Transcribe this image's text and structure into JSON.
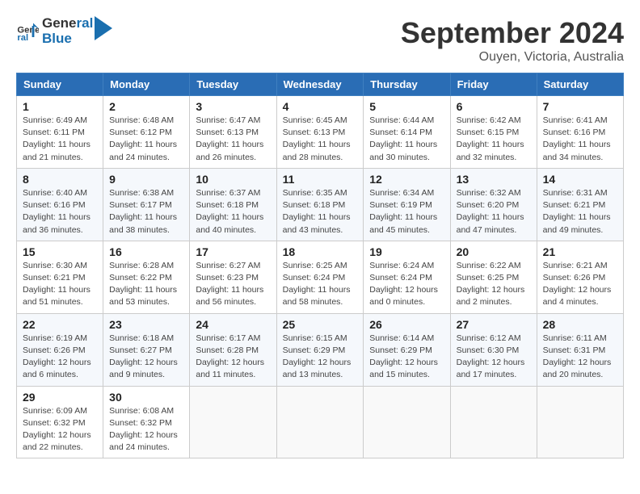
{
  "header": {
    "logo_line1": "General",
    "logo_line2": "Blue",
    "month_year": "September 2024",
    "location": "Ouyen, Victoria, Australia"
  },
  "weekdays": [
    "Sunday",
    "Monday",
    "Tuesday",
    "Wednesday",
    "Thursday",
    "Friday",
    "Saturday"
  ],
  "weeks": [
    [
      {
        "day": "1",
        "sunrise": "6:49 AM",
        "sunset": "6:11 PM",
        "daylight": "11 hours and 21 minutes."
      },
      {
        "day": "2",
        "sunrise": "6:48 AM",
        "sunset": "6:12 PM",
        "daylight": "11 hours and 24 minutes."
      },
      {
        "day": "3",
        "sunrise": "6:47 AM",
        "sunset": "6:13 PM",
        "daylight": "11 hours and 26 minutes."
      },
      {
        "day": "4",
        "sunrise": "6:45 AM",
        "sunset": "6:13 PM",
        "daylight": "11 hours and 28 minutes."
      },
      {
        "day": "5",
        "sunrise": "6:44 AM",
        "sunset": "6:14 PM",
        "daylight": "11 hours and 30 minutes."
      },
      {
        "day": "6",
        "sunrise": "6:42 AM",
        "sunset": "6:15 PM",
        "daylight": "11 hours and 32 minutes."
      },
      {
        "day": "7",
        "sunrise": "6:41 AM",
        "sunset": "6:16 PM",
        "daylight": "11 hours and 34 minutes."
      }
    ],
    [
      {
        "day": "8",
        "sunrise": "6:40 AM",
        "sunset": "6:16 PM",
        "daylight": "11 hours and 36 minutes."
      },
      {
        "day": "9",
        "sunrise": "6:38 AM",
        "sunset": "6:17 PM",
        "daylight": "11 hours and 38 minutes."
      },
      {
        "day": "10",
        "sunrise": "6:37 AM",
        "sunset": "6:18 PM",
        "daylight": "11 hours and 40 minutes."
      },
      {
        "day": "11",
        "sunrise": "6:35 AM",
        "sunset": "6:18 PM",
        "daylight": "11 hours and 43 minutes."
      },
      {
        "day": "12",
        "sunrise": "6:34 AM",
        "sunset": "6:19 PM",
        "daylight": "11 hours and 45 minutes."
      },
      {
        "day": "13",
        "sunrise": "6:32 AM",
        "sunset": "6:20 PM",
        "daylight": "11 hours and 47 minutes."
      },
      {
        "day": "14",
        "sunrise": "6:31 AM",
        "sunset": "6:21 PM",
        "daylight": "11 hours and 49 minutes."
      }
    ],
    [
      {
        "day": "15",
        "sunrise": "6:30 AM",
        "sunset": "6:21 PM",
        "daylight": "11 hours and 51 minutes."
      },
      {
        "day": "16",
        "sunrise": "6:28 AM",
        "sunset": "6:22 PM",
        "daylight": "11 hours and 53 minutes."
      },
      {
        "day": "17",
        "sunrise": "6:27 AM",
        "sunset": "6:23 PM",
        "daylight": "11 hours and 56 minutes."
      },
      {
        "day": "18",
        "sunrise": "6:25 AM",
        "sunset": "6:24 PM",
        "daylight": "11 hours and 58 minutes."
      },
      {
        "day": "19",
        "sunrise": "6:24 AM",
        "sunset": "6:24 PM",
        "daylight": "12 hours and 0 minutes."
      },
      {
        "day": "20",
        "sunrise": "6:22 AM",
        "sunset": "6:25 PM",
        "daylight": "12 hours and 2 minutes."
      },
      {
        "day": "21",
        "sunrise": "6:21 AM",
        "sunset": "6:26 PM",
        "daylight": "12 hours and 4 minutes."
      }
    ],
    [
      {
        "day": "22",
        "sunrise": "6:19 AM",
        "sunset": "6:26 PM",
        "daylight": "12 hours and 6 minutes."
      },
      {
        "day": "23",
        "sunrise": "6:18 AM",
        "sunset": "6:27 PM",
        "daylight": "12 hours and 9 minutes."
      },
      {
        "day": "24",
        "sunrise": "6:17 AM",
        "sunset": "6:28 PM",
        "daylight": "12 hours and 11 minutes."
      },
      {
        "day": "25",
        "sunrise": "6:15 AM",
        "sunset": "6:29 PM",
        "daylight": "12 hours and 13 minutes."
      },
      {
        "day": "26",
        "sunrise": "6:14 AM",
        "sunset": "6:29 PM",
        "daylight": "12 hours and 15 minutes."
      },
      {
        "day": "27",
        "sunrise": "6:12 AM",
        "sunset": "6:30 PM",
        "daylight": "12 hours and 17 minutes."
      },
      {
        "day": "28",
        "sunrise": "6:11 AM",
        "sunset": "6:31 PM",
        "daylight": "12 hours and 20 minutes."
      }
    ],
    [
      {
        "day": "29",
        "sunrise": "6:09 AM",
        "sunset": "6:32 PM",
        "daylight": "12 hours and 22 minutes."
      },
      {
        "day": "30",
        "sunrise": "6:08 AM",
        "sunset": "6:32 PM",
        "daylight": "12 hours and 24 minutes."
      },
      null,
      null,
      null,
      null,
      null
    ]
  ]
}
